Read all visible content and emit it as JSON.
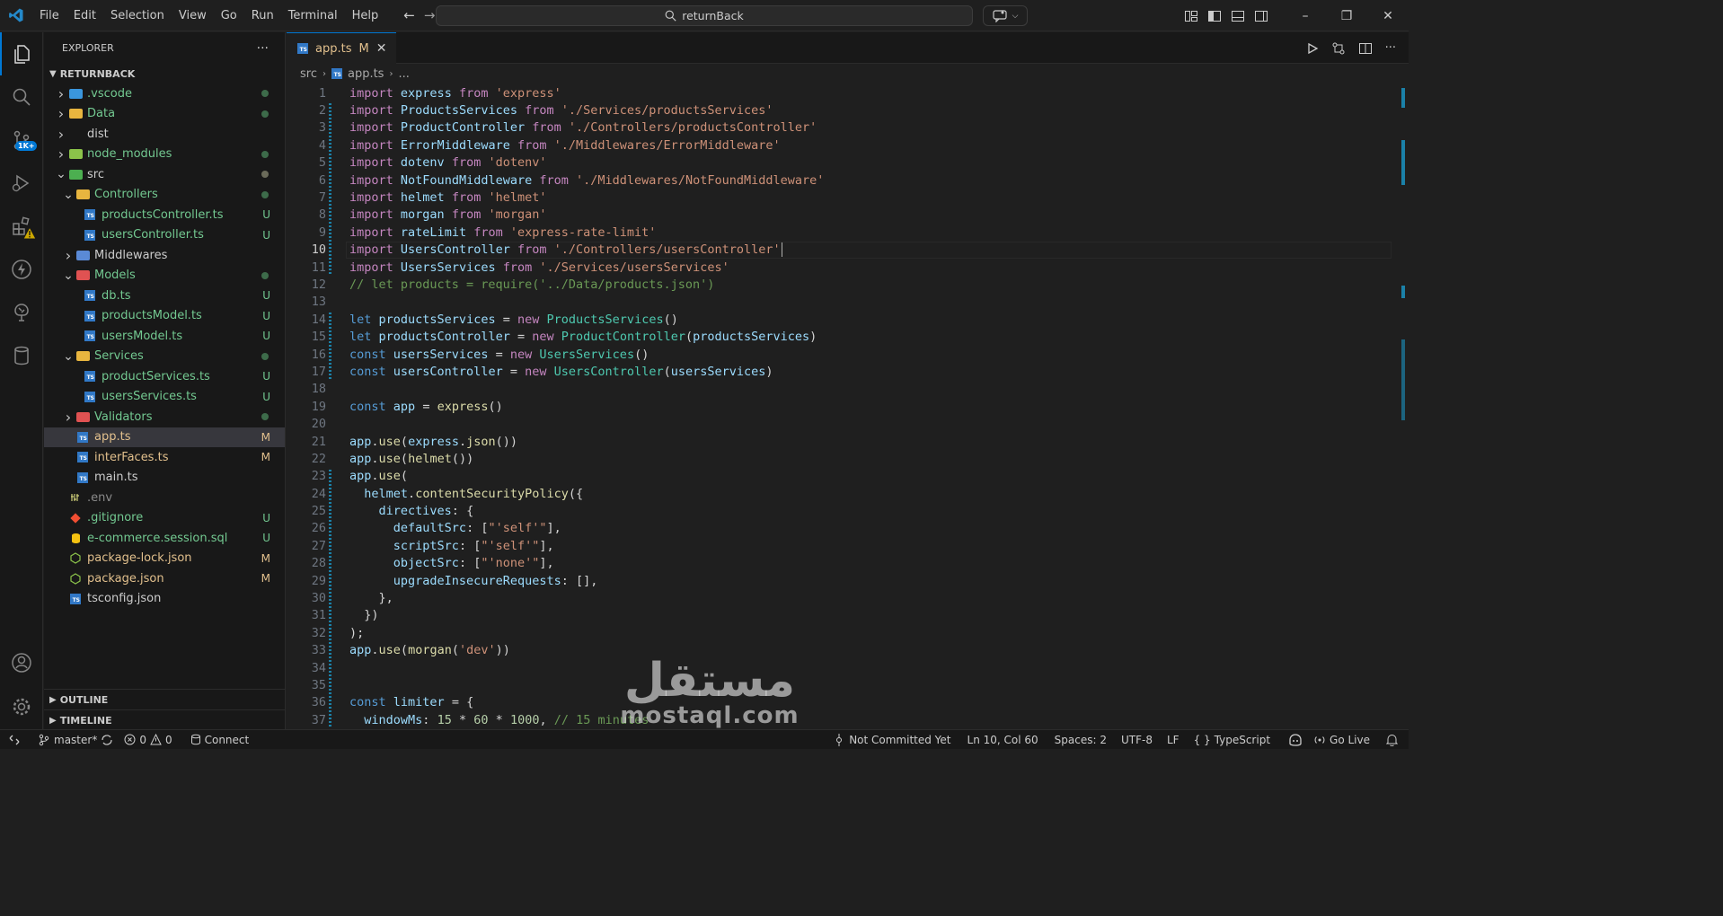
{
  "menu": [
    "File",
    "Edit",
    "Selection",
    "View",
    "Go",
    "Run",
    "Terminal",
    "Help"
  ],
  "search": {
    "text": "returnBack"
  },
  "activity": {
    "badge": "1K+"
  },
  "explorer": {
    "title": "EXPLORER",
    "more": "···",
    "root": "RETURNBACK",
    "items": [
      {
        "label": ".vscode",
        "status": "dot",
        "depth": 1
      },
      {
        "label": "Data",
        "status": "dot",
        "depth": 1
      },
      {
        "label": "dist",
        "status": "",
        "depth": 1
      },
      {
        "label": "node_modules",
        "status": "dot",
        "depth": 1
      },
      {
        "label": "src",
        "status": "dot",
        "depth": 1
      },
      {
        "label": "Controllers",
        "status": "dot",
        "depth": 2
      },
      {
        "label": "productsController.ts",
        "status": "U",
        "depth": 3
      },
      {
        "label": "usersController.ts",
        "status": "U",
        "depth": 3
      },
      {
        "label": "Middlewares",
        "status": "",
        "depth": 2
      },
      {
        "label": "Models",
        "status": "dot",
        "depth": 2
      },
      {
        "label": "db.ts",
        "status": "U",
        "depth": 3
      },
      {
        "label": "productsModel.ts",
        "status": "U",
        "depth": 3
      },
      {
        "label": "usersModel.ts",
        "status": "U",
        "depth": 3
      },
      {
        "label": "Services",
        "status": "dot",
        "depth": 2
      },
      {
        "label": "productServices.ts",
        "status": "U",
        "depth": 3
      },
      {
        "label": "usersServices.ts",
        "status": "U",
        "depth": 3
      },
      {
        "label": "Validators",
        "status": "dot",
        "depth": 2
      },
      {
        "label": "app.ts",
        "status": "M",
        "depth": 2
      },
      {
        "label": "interFaces.ts",
        "status": "M",
        "depth": 2
      },
      {
        "label": "main.ts",
        "status": "",
        "depth": 2
      },
      {
        "label": ".env",
        "status": "",
        "depth": 1
      },
      {
        "label": ".gitignore",
        "status": "U",
        "depth": 1
      },
      {
        "label": "e-commerce.session.sql",
        "status": "U",
        "depth": 1
      },
      {
        "label": "package-lock.json",
        "status": "M",
        "depth": 1
      },
      {
        "label": "package.json",
        "status": "M",
        "depth": 1
      },
      {
        "label": "tsconfig.json",
        "status": "",
        "depth": 1
      }
    ],
    "outline": "OUTLINE",
    "timeline": "TIMELINE"
  },
  "tab": {
    "name": "app.ts",
    "status": "M"
  },
  "breadcrumb": {
    "folder": "src",
    "file": "app.ts",
    "more": "..."
  },
  "code": [
    "import express from 'express'",
    "import ProductsServices from './Services/productsServices'",
    "import ProductController from './Controllers/productsController'",
    "import ErrorMiddleware from './Middlewares/ErrorMiddleware'",
    "import dotenv from 'dotenv'",
    "import NotFoundMiddleware from './Middlewares/NotFoundMiddleware'",
    "import helmet from 'helmet'",
    "import morgan from 'morgan'",
    "import rateLimit from 'express-rate-limit'",
    "import UsersController from './Controllers/usersController'",
    "import UsersServices from './Services/usersServices'",
    "// let products = require('../Data/products.json')",
    "",
    "let productsServices = new ProductsServices()",
    "let productsController = new ProductController(productsServices)",
    "const usersServices = new UsersServices()",
    "const usersController = new UsersController(usersServices)",
    "",
    "const app = express()",
    "",
    "app.use(express.json())",
    "app.use(helmet())",
    "app.use(",
    "  helmet.contentSecurityPolicy({",
    "    directives: {",
    "      defaultSrc: [\"'self'\"],",
    "      scriptSrc: [\"'self'\"],",
    "      objectSrc: [\"'none'\"],",
    "      upgradeInsecureRequests: [],",
    "    },",
    "  })",
    ");",
    "app.use(morgan('dev'))",
    "",
    "",
    "const limiter = {",
    "  windowMs: 15 * 60 * 1000, // 15 minutes"
  ],
  "current_line": 10,
  "status": {
    "branch": "master*",
    "errors": "0",
    "warnings": "0",
    "connect": "Connect",
    "blame": "Not Committed Yet",
    "position": "Ln 10, Col 60",
    "spaces": "Spaces: 2",
    "encoding": "UTF-8",
    "eol": "LF",
    "language": "TypeScript",
    "golive": "Go Live"
  },
  "watermark": {
    "arabic": "مستقل",
    "latin": "mostaql.com"
  },
  "colors": {
    "accent": "#0078d4",
    "modified": "#e2c08d",
    "untracked": "#73c991"
  }
}
